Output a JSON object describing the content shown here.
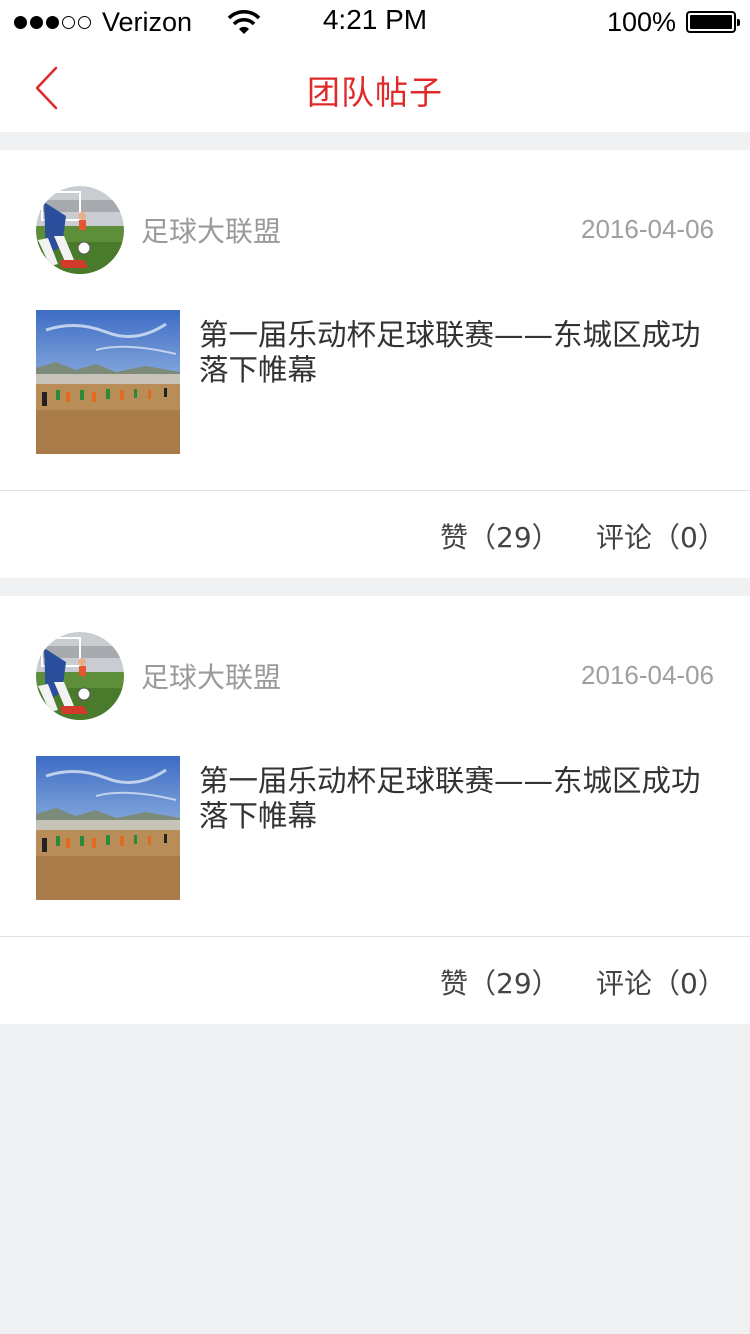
{
  "status_bar": {
    "carrier": "Verizon",
    "time": "4:21 PM",
    "battery": "100%"
  },
  "nav": {
    "title": "团队帖子"
  },
  "colors": {
    "accent": "#e02a2a",
    "background": "#f0f1f3"
  },
  "posts": [
    {
      "author": "足球大联盟",
      "date": "2016-04-06",
      "title": "第一届乐动杯足球联赛——东城区成功落下帷幕",
      "likes_label": "赞（29）",
      "comments_label": "评论（0）"
    },
    {
      "author": "足球大联盟",
      "date": "2016-04-06",
      "title": "第一届乐动杯足球联赛——东城区成功落下帷幕",
      "likes_label": "赞（29）",
      "comments_label": "评论（0）"
    }
  ]
}
